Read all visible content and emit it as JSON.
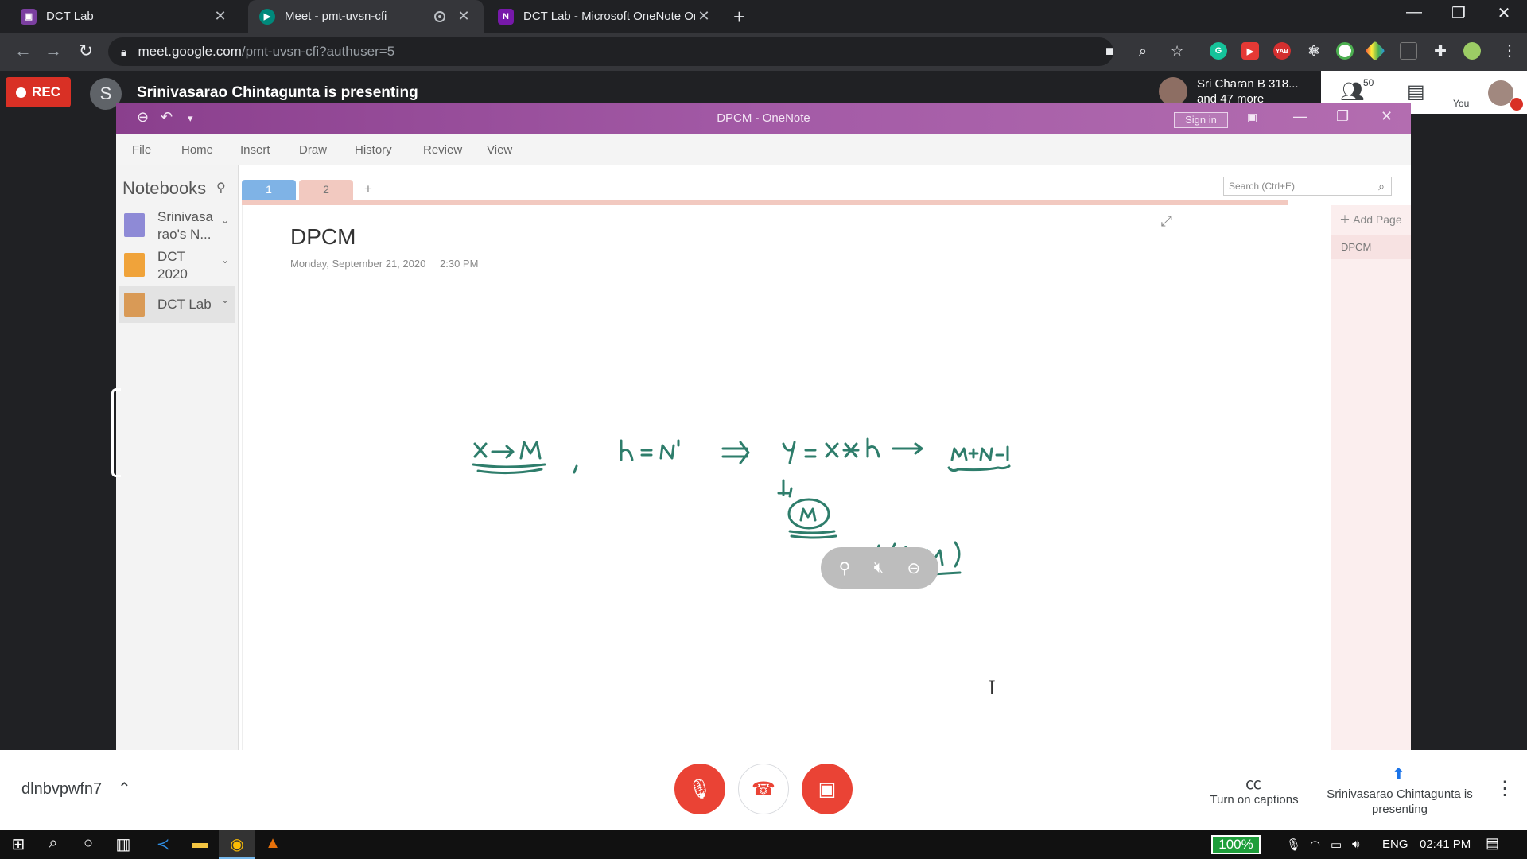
{
  "browser": {
    "tabs": [
      {
        "title": "DCT Lab",
        "favicon_color": "#7b3fa0"
      },
      {
        "title": "Meet - pmt-uvsn-cfi",
        "favicon_color": "#00897b"
      },
      {
        "title": "DCT Lab - Microsoft OneNote Or",
        "favicon_color": "#7719aa"
      }
    ],
    "url_host": "meet.google.com",
    "url_path": "/pmt-uvsn-cfi?authuser=5"
  },
  "meet": {
    "rec_label": "REC",
    "presenter_initial": "S",
    "presenting_text": "Srinivasarao Chintagunta is presenting",
    "participant_name": "Sri Charan B 318...",
    "participant_more": "and 47 more",
    "participant_count": "50",
    "you_label": "You",
    "meeting_code": "dlnbvpwfn7",
    "captions_label": "Turn on captions",
    "presenting_label": "Srinivasarao Chintagunta is presenting"
  },
  "onenote": {
    "window_title": "DPCM - OneNote",
    "signin_label": "Sign in",
    "ribbon": [
      "File",
      "Home",
      "Insert",
      "Draw",
      "History",
      "Review",
      "View"
    ],
    "notebooks_header": "Notebooks",
    "notebooks": [
      {
        "label": "Srinivasa rao's N...",
        "color": "#8e8ad6"
      },
      {
        "label": "DCT 2020",
        "color": "#f0a33a"
      },
      {
        "label": "DCT Lab",
        "color": "#d99a56"
      }
    ],
    "section_tabs": [
      "1",
      "2"
    ],
    "search_placeholder": "Search (Ctrl+E)",
    "add_page_label": "Add Page",
    "page_list": [
      "DPCM"
    ],
    "page_title": "DPCM",
    "page_date": "Monday, September 21, 2020",
    "page_time": "2:30 PM"
  },
  "taskbar": {
    "battery": "100%",
    "lang": "ENG",
    "time": "02:41 PM"
  },
  "colors": {
    "meet_red": "#ea4335",
    "onenote_purple": "#8a3f8d",
    "chrome_dark": "#202124"
  }
}
